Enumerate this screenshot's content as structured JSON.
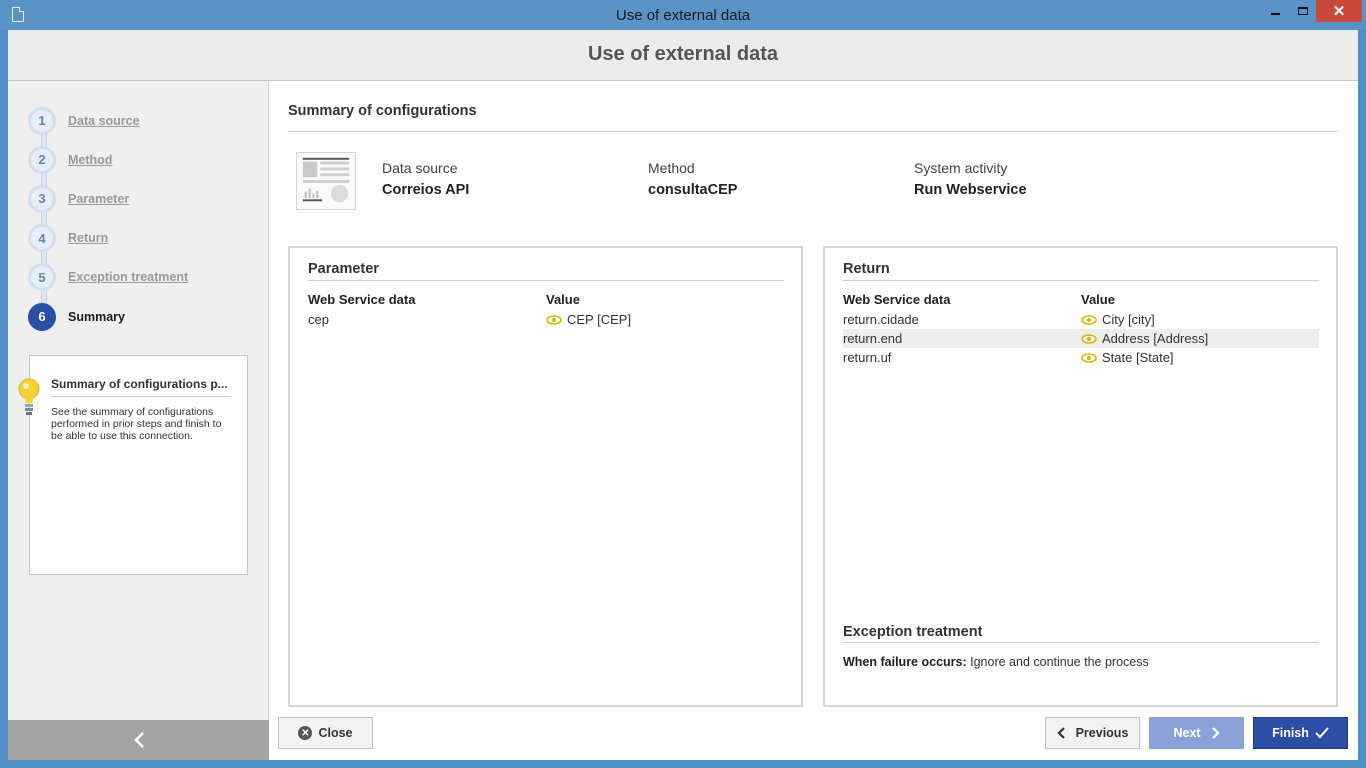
{
  "window": {
    "title": "Use of external data"
  },
  "header": {
    "title": "Use of external data"
  },
  "steps": [
    {
      "num": "1",
      "label": "Data source",
      "active": false
    },
    {
      "num": "2",
      "label": "Method",
      "active": false
    },
    {
      "num": "3",
      "label": "Parameter",
      "active": false
    },
    {
      "num": "4",
      "label": "Return",
      "active": false
    },
    {
      "num": "5",
      "label": "Exception treatment",
      "active": false
    },
    {
      "num": "6",
      "label": "Summary",
      "active": true
    }
  ],
  "tip": {
    "title": "Summary of configurations p...",
    "text": "See the summary of configurations performed in prior steps and finish to be able to use this connection.",
    "icon": "lightbulb-icon"
  },
  "main": {
    "section_title": "Summary of configurations",
    "info": [
      {
        "label": "Data source",
        "value": "Correios API"
      },
      {
        "label": "Method",
        "value": "consultaCEP"
      },
      {
        "label": "System activity",
        "value": "Run Webservice"
      }
    ]
  },
  "parameter_panel": {
    "title": "Parameter",
    "col1": "Web Service data",
    "col2": "Value",
    "rows": [
      {
        "key": "cep",
        "value": "CEP [CEP]"
      }
    ]
  },
  "return_panel": {
    "title": "Return",
    "col1": "Web Service data",
    "col2": "Value",
    "rows": [
      {
        "key": "return.cidade",
        "value": "City [city]"
      },
      {
        "key": "return.end",
        "value": "Address [Address]"
      },
      {
        "key": "return.uf",
        "value": "State [State]"
      }
    ],
    "exception_title": "Exception treatment",
    "exception_label": "When failure occurs:",
    "exception_value": "Ignore and continue the process"
  },
  "buttons": {
    "close": "Close",
    "previous": "Previous",
    "next": "Next",
    "finish": "Finish"
  },
  "colors": {
    "accent": "#2d4ea6",
    "eye_icon": "#d6b800",
    "titlebar": "#5a93c6"
  }
}
